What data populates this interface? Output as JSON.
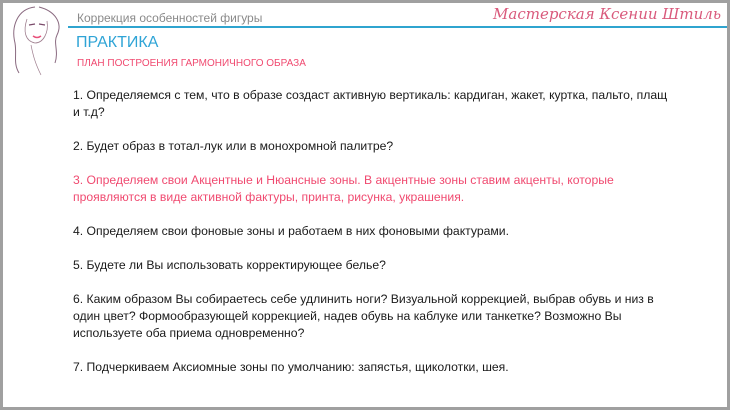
{
  "header": {
    "subtitle": "Коррекция особенностей фигуры",
    "brand": "Мастерская Ксении Штиль",
    "title": "ПРАКТИКА",
    "heading": "ПЛАН ПОСТРОЕНИЯ ГАРМОНИЧНОГО ОБРАЗА"
  },
  "items": [
    "1. Определяемся с тем, что в образе создаст активную вертикаль: кардиган, жакет, куртка, пальто, плащ и т.д?",
    "2. Будет образ в тотал-лук или в монохромной палитре?",
    "3. Определяем свои Акцентные и Нюансные зоны. В акцентные зоны ставим акценты, которые проявляются в виде активной фактуры, принта, рисунка, украшения.",
    "4. Определяем свои фоновые зоны и работаем в них фоновыми фактурами.",
    "5. Будете ли Вы использовать корректирующее белье?",
    "6. Каким образом Вы собираетесь себе удлинить ноги? Визуальной коррекцией, выбрав обувь и низ в один цвет? Формообразующей коррекцией, надев обувь на каблуке или танкетке? Возможно Вы используете оба приема одновременно?",
    "7. Подчеркиваем Аксиомные зоны по умолчанию: запястья, щиколотки, шея."
  ],
  "colors": {
    "accent": "#2fa4d6",
    "highlight": "#f04a70"
  }
}
